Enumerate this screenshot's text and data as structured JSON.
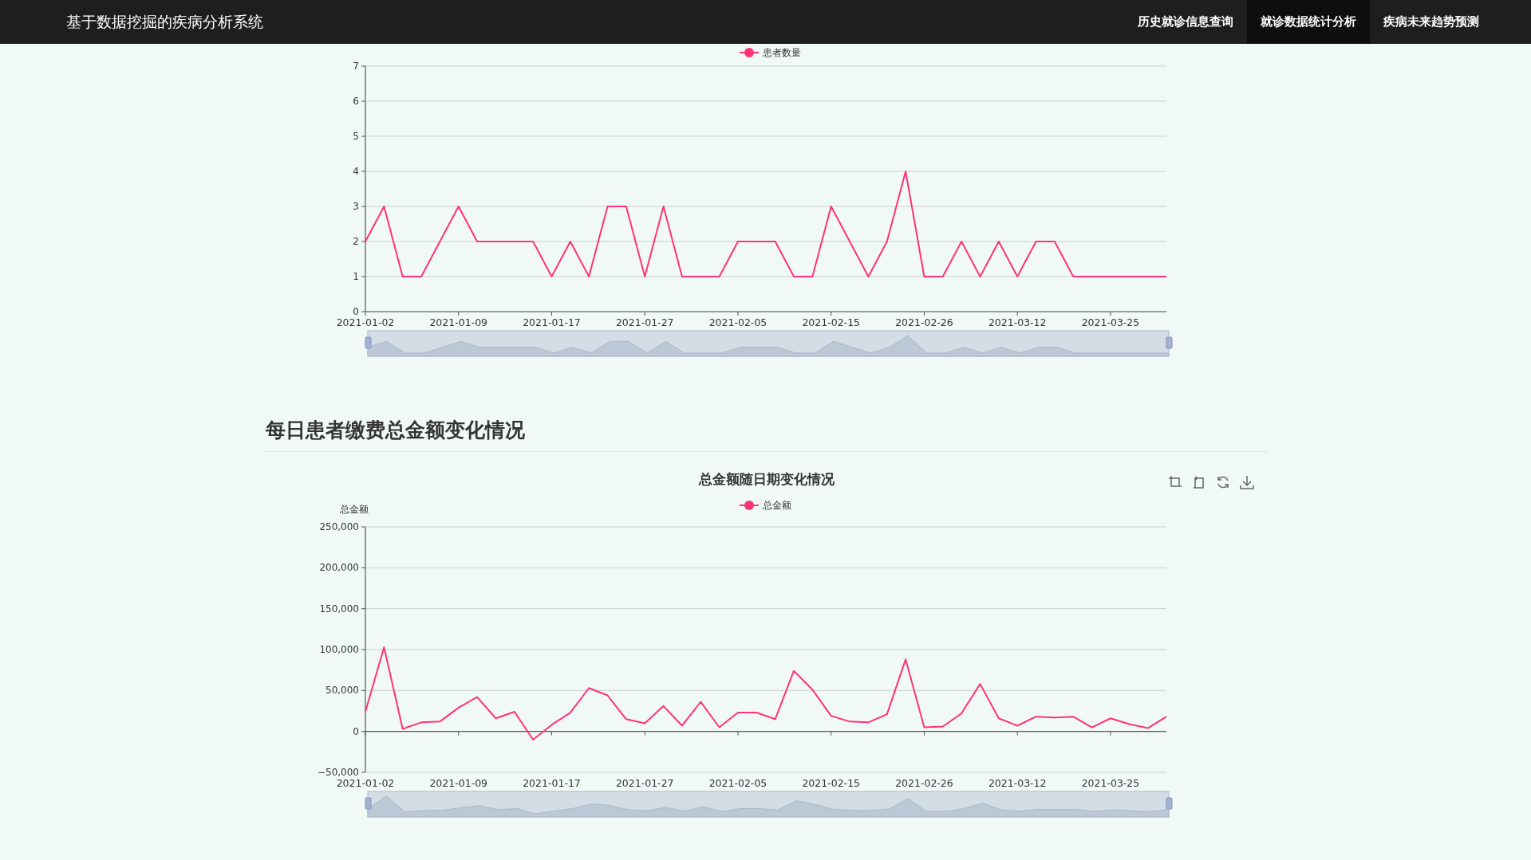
{
  "header": {
    "title": "基于数据挖掘的疾病分析系统",
    "nav": [
      {
        "label": "历史就诊信息查询",
        "selected": false
      },
      {
        "label": "就诊数据统计分析",
        "selected": true
      },
      {
        "label": "疾病未来趋势预测",
        "selected": false
      }
    ]
  },
  "sections": [
    {
      "chart_data": {
        "type": "line",
        "grid": true,
        "ylim": [
          0,
          7
        ],
        "yticks": [
          0,
          1,
          2,
          3,
          4,
          5,
          6,
          7
        ],
        "categories": [
          "2021-01-02",
          null,
          null,
          null,
          null,
          "2021-01-09",
          null,
          null,
          null,
          null,
          "2021-01-17",
          null,
          null,
          null,
          null,
          "2021-01-27",
          null,
          null,
          null,
          null,
          "2021-02-05",
          null,
          null,
          null,
          null,
          "2021-02-15",
          null,
          null,
          null,
          null,
          "2021-02-26",
          null,
          null,
          null,
          null,
          "2021-03-12",
          null,
          null,
          null,
          null,
          "2021-03-25",
          null,
          null,
          null
        ],
        "series": [
          {
            "name": "患者数量",
            "color": "#ff3377",
            "values": [
              2,
              3,
              1,
              1,
              2,
              3,
              2,
              2,
              2,
              2,
              1,
              2,
              1,
              3,
              3,
              1,
              3,
              1,
              1,
              1,
              2,
              2,
              2,
              1,
              1,
              3,
              2,
              1,
              2,
              4,
              1,
              1,
              2,
              1,
              2,
              1,
              2,
              2,
              1,
              1,
              1,
              1,
              1,
              1
            ]
          }
        ]
      }
    },
    {
      "title": "每日患者缴费总金额变化情况",
      "toolbar": true,
      "chart_data": {
        "type": "line",
        "grid": true,
        "title": "总金额随日期变化情况",
        "ylabel": "总金额",
        "ylim": [
          -50000,
          250000
        ],
        "yticks": [
          {
            "value": -50000,
            "label": "−50,000"
          },
          {
            "value": 0,
            "label": "0"
          },
          {
            "value": 50000,
            "label": "50,000"
          },
          {
            "value": 100000,
            "label": "100,000"
          },
          {
            "value": 150000,
            "label": "150,000"
          },
          {
            "value": 200000,
            "label": "200,000"
          },
          {
            "value": 250000,
            "label": "250,000"
          }
        ],
        "categories": [
          "2021-01-02",
          null,
          null,
          null,
          null,
          "2021-01-09",
          null,
          null,
          null,
          null,
          "2021-01-17",
          null,
          null,
          null,
          null,
          "2021-01-27",
          null,
          null,
          null,
          null,
          "2021-02-05",
          null,
          null,
          null,
          null,
          "2021-02-15",
          null,
          null,
          null,
          null,
          "2021-02-26",
          null,
          null,
          null,
          null,
          "2021-03-12",
          null,
          null,
          null,
          null,
          "2021-03-25",
          null,
          null,
          null
        ],
        "series": [
          {
            "name": "总金额",
            "color": "#ff3377",
            "values": [
              24000,
              103000,
              3000,
              11000,
              12000,
              29000,
              42000,
              16000,
              24000,
              -10000,
              8000,
              23000,
              53000,
              44000,
              15000,
              10000,
              31000,
              7000,
              36000,
              5000,
              23000,
              23000,
              15000,
              74000,
              51000,
              19000,
              12000,
              11000,
              21000,
              88000,
              5000,
              6000,
              22000,
              58000,
              16000,
              7000,
              18000,
              17000,
              18000,
              5000,
              16000,
              9000,
              4000,
              18000
            ]
          }
        ]
      }
    }
  ]
}
